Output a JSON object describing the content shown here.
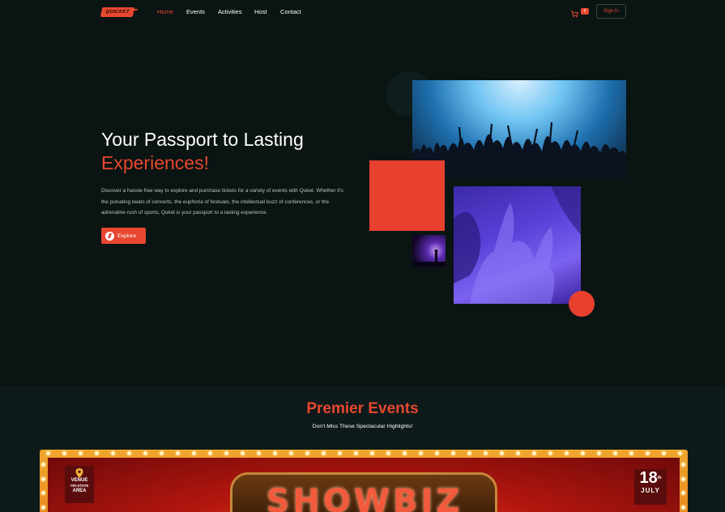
{
  "nav": {
    "logo_text": "QUICKET",
    "links": [
      "Home",
      "Events",
      "Activities",
      "Host",
      "Contact"
    ],
    "active_link": "Home",
    "cart_count": "0",
    "signin_label": "Sign In"
  },
  "hero": {
    "title_line1": "Your Passport to Lasting",
    "title_line2": "Experiences!",
    "description": "Discover a hassle-free way to explore and purchase tickets for a variety of events with Quket. Whether it's the pulsating beats of concerts, the euphoria of festivals, the intellectual buzz of conferences, or the adrenaline rush of sports, Quket is your passport to a lasting experience.",
    "explore_label": "Explore"
  },
  "events": {
    "title": "Premier Events",
    "subtitle": "Don't Miss These Spectacular Highlights!",
    "banner": {
      "venue_line1": "VENUE",
      "venue_line2": "TRI-STATE",
      "venue_line3": "AREA",
      "date_day": "18",
      "date_suffix": "th",
      "date_month": "JULY",
      "marquee_text": "SHOWBIZ"
    }
  },
  "colors": {
    "accent": "#e8472f",
    "background": "#0a1413",
    "section_bg": "#0d1a19"
  }
}
